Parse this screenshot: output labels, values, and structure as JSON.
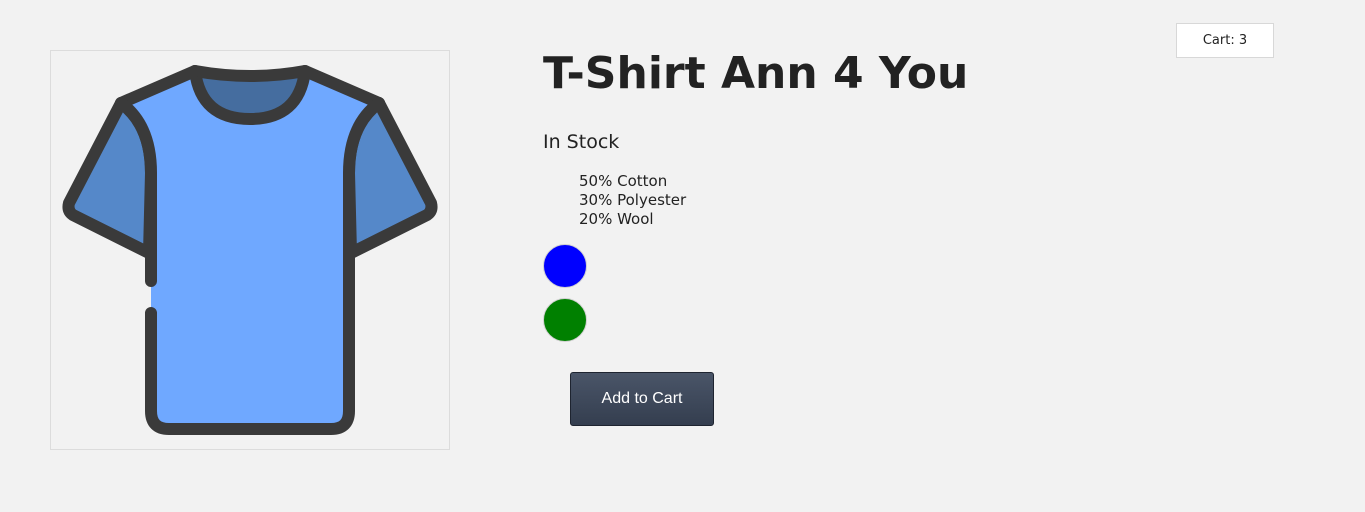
{
  "cart": {
    "label": "Cart: 3"
  },
  "product": {
    "title": "T-Shirt Ann 4 You",
    "image_icon": "t-shirt-icon",
    "stock_status": "In Stock",
    "details": [
      "50% Cotton",
      "30% Polyester",
      "20% Wool"
    ],
    "variants": [
      {
        "color": "#0000ff"
      },
      {
        "color": "#008000"
      }
    ],
    "add_to_cart_label": "Add to Cart"
  },
  "colors": {
    "shirt_body": "#6fa8ff",
    "shirt_sleeves": "#5588c9",
    "shirt_collar": "#456d9f",
    "shirt_outline": "#3a3a3a",
    "button_bg": "#3f4859",
    "page_bg": "#f2f2f2"
  }
}
